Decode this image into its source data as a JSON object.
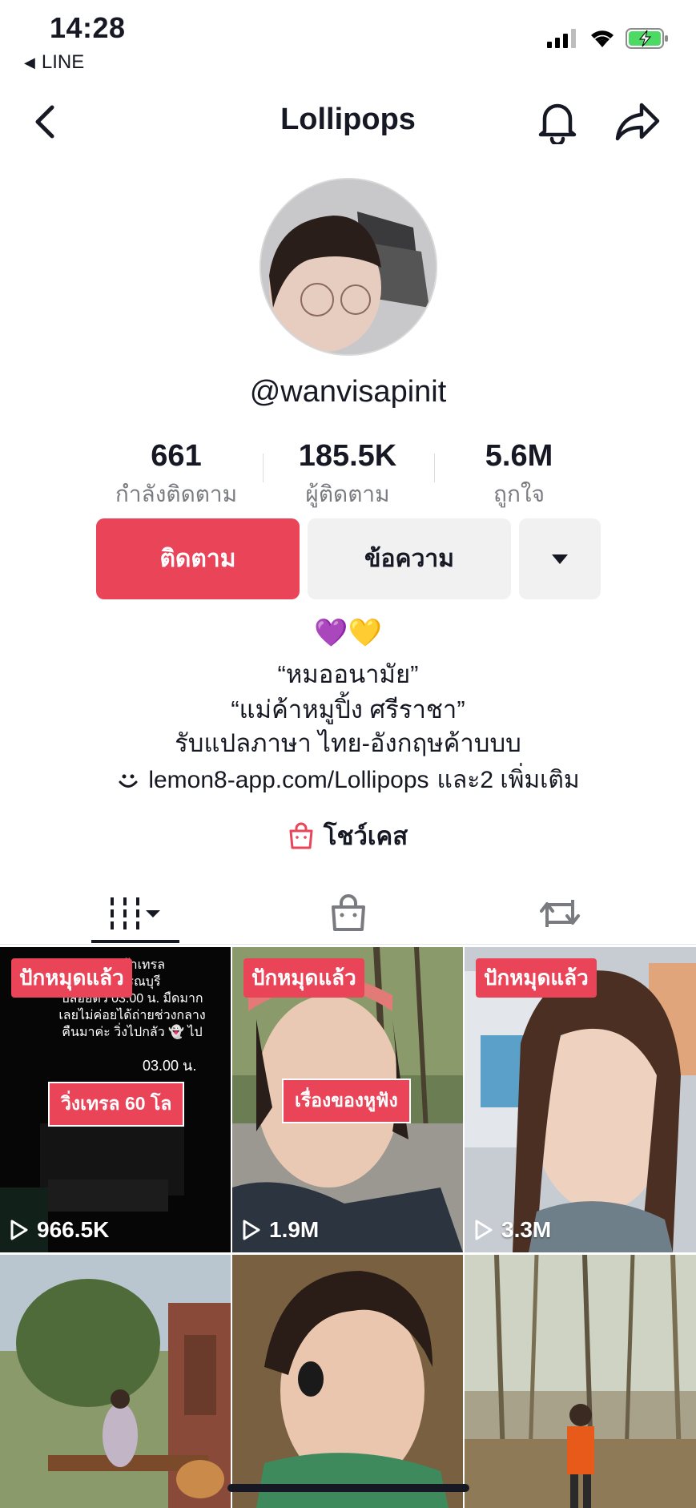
{
  "status_bar": {
    "time": "14:28",
    "back_app": "LINE"
  },
  "nav": {
    "title": "Lollipops"
  },
  "profile": {
    "username": "@wanvisapinit",
    "stats": [
      {
        "value": "661",
        "label": "กำลังติดตาม"
      },
      {
        "value": "185.5K",
        "label": "ผู้ติดตาม"
      },
      {
        "value": "5.6M",
        "label": "ถูกใจ"
      }
    ],
    "buttons": {
      "follow": "ติดตาม",
      "message": "ข้อความ"
    },
    "bio": {
      "emojis": "💜💛",
      "line1": "“หมออนามัย”",
      "line2": "“แม่ค้าหมูปิ้ง ศรีราชา”",
      "line3": "รับแปลภาษา ไทย-อังกฤษค้าบบบ",
      "link": "lemon8-app.com/Lollipops",
      "more": "และ2 เพิ่มเติม"
    },
    "showcase": "โชว์เคส"
  },
  "videos": [
    {
      "pinned": "ปักหมุดแล้ว",
      "views": "966.5K",
      "caption": "วิ่งเทรล 60 โล",
      "overlay_lines": [
        "ลัลตร้าเทรล",
        "สุพรรณบุรี",
        "ปล่อยตัว 03.00 น. มืดมาก",
        "เลยไม่ค่อยได้ถ่ายช่วงกลาง",
        "คืนมาค่ะ วิ่งไปกลัว 👻 ไป"
      ],
      "overlay_time": "03.00 น."
    },
    {
      "pinned": "ปักหมุดแล้ว",
      "views": "1.9M",
      "caption": "เรื่องของหูฟัง"
    },
    {
      "pinned": "ปักหมุดแล้ว",
      "views": "3.3M"
    },
    {},
    {},
    {}
  ],
  "colors": {
    "accent": "#ea4459",
    "text": "#161823",
    "muted": "#7a7b80",
    "button_bg": "#f1f1f2"
  }
}
